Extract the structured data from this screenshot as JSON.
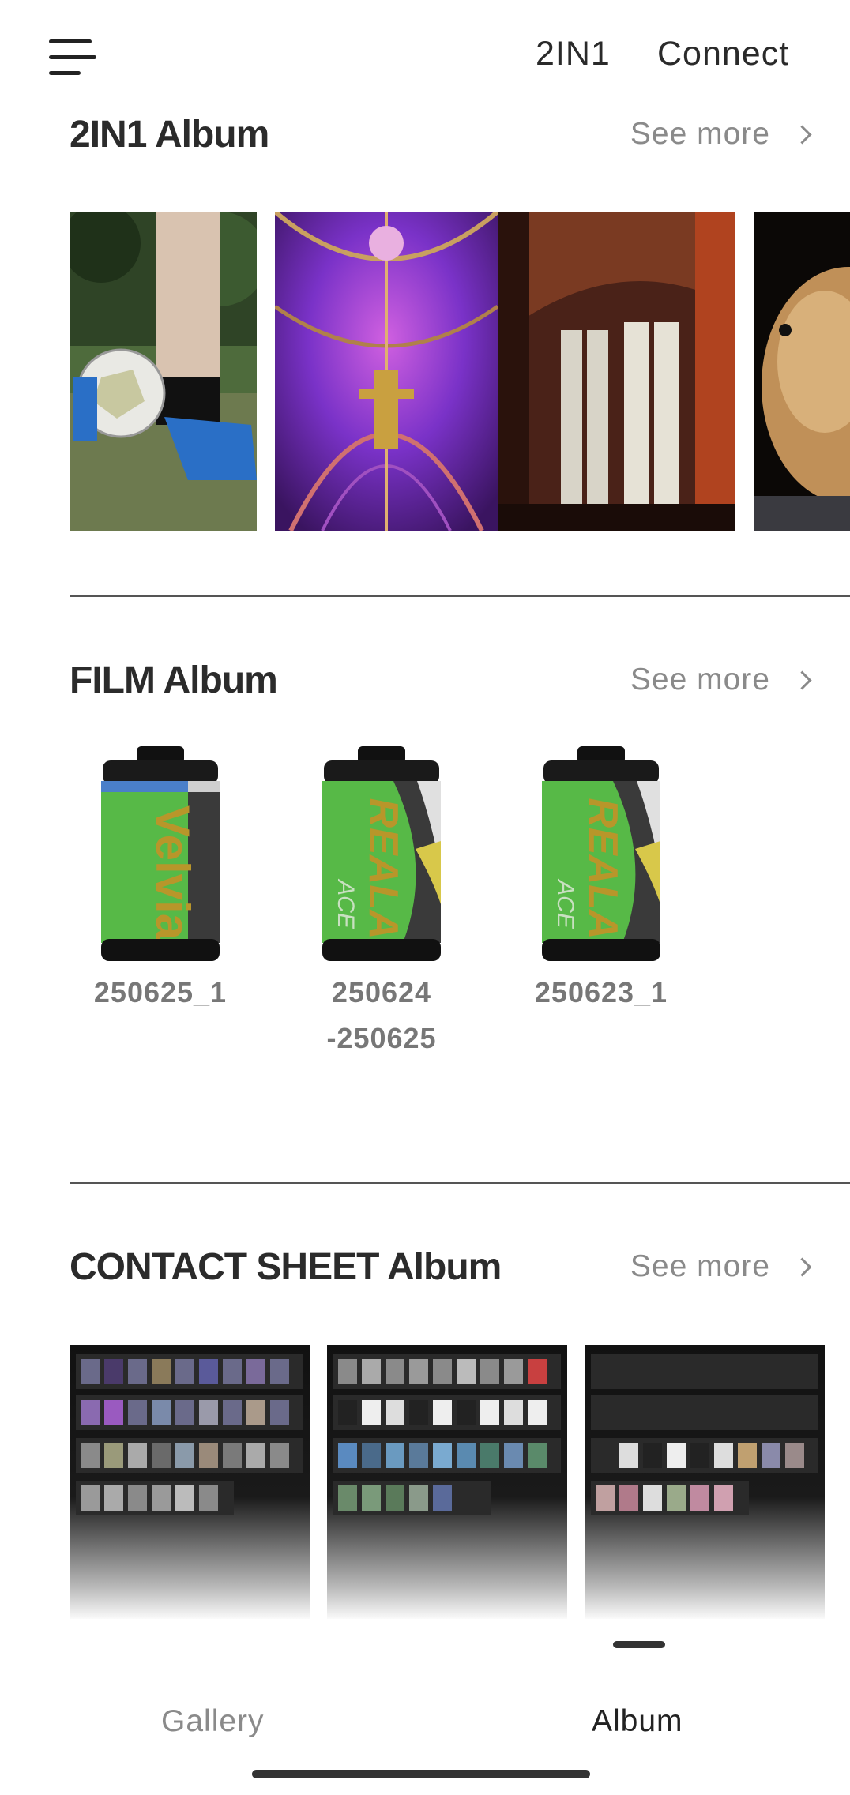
{
  "header": {
    "link_2in1": "2IN1",
    "link_connect": "Connect"
  },
  "sections": {
    "twoinone": {
      "title": "2IN1 Album",
      "see_more": "See more"
    },
    "film": {
      "title": "FILM Album",
      "see_more": "See more",
      "rolls": [
        {
          "label": "250625_1",
          "brand": "Velvia",
          "sub": ""
        },
        {
          "label": "250624\n-250625",
          "brand": "REALA",
          "sub": "ACE"
        },
        {
          "label": "250623_1",
          "brand": "REALA",
          "sub": "ACE"
        }
      ]
    },
    "contact": {
      "title": "CONTACT SHEET Album",
      "see_more": "See more"
    }
  },
  "nav": {
    "gallery": "Gallery",
    "album": "Album",
    "active": "Album"
  },
  "colors": {
    "film_green": "#57b947",
    "film_dark": "#3a3a3a",
    "velvia_blue": "#4a7fc9",
    "reala_yellow": "#d8c84a",
    "brand_gold": "#b8962a"
  }
}
